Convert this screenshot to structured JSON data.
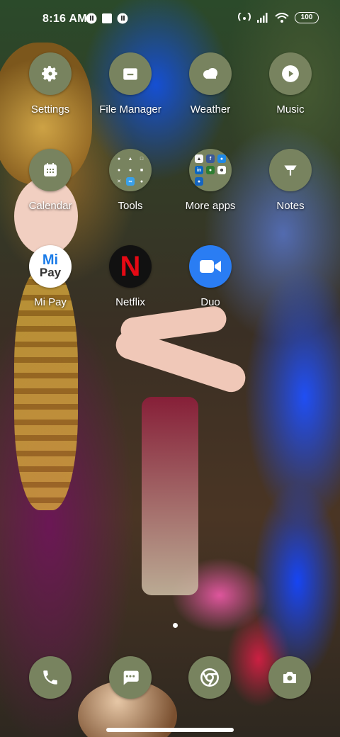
{
  "status_bar": {
    "time": "8:16 AM",
    "battery": "100",
    "icons": [
      "notification-icon",
      "notification-icon",
      "notification-icon",
      "hotspot-icon",
      "signal-icon",
      "wifi-icon",
      "battery-icon"
    ]
  },
  "apps": [
    {
      "label": "Settings",
      "icon": "gear-icon"
    },
    {
      "label": "File Manager",
      "icon": "folder-icon"
    },
    {
      "label": "Weather",
      "icon": "cloud-icon"
    },
    {
      "label": "Music",
      "icon": "play-icon"
    },
    {
      "label": "Calendar",
      "icon": "calendar-icon"
    },
    {
      "label": "Tools",
      "icon": "tools-folder-icon"
    },
    {
      "label": "More apps",
      "icon": "apps-folder-icon"
    },
    {
      "label": "Notes",
      "icon": "notes-icon"
    },
    {
      "label": "Mi Pay",
      "icon": "mi-pay-icon",
      "logo_top": "Mi",
      "logo_bottom": "Pay"
    },
    {
      "label": "Netflix",
      "icon": "netflix-icon",
      "logo": "N"
    },
    {
      "label": "Duo",
      "icon": "duo-icon"
    }
  ],
  "dock": [
    {
      "icon": "phone-icon"
    },
    {
      "icon": "messages-icon"
    },
    {
      "icon": "chrome-icon"
    },
    {
      "icon": "camera-icon"
    }
  ],
  "theme": {
    "icon_bg": "#78835f",
    "netflix_red": "#e50914",
    "duo_blue": "#2a7df3"
  }
}
